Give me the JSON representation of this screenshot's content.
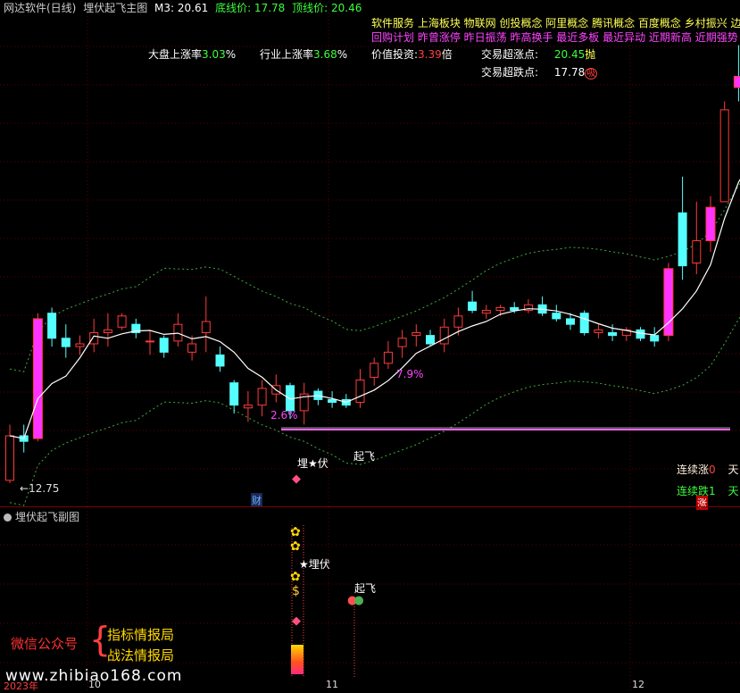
{
  "header": {
    "app": "网达软件(日线)",
    "indicator": "埋伏起飞主图",
    "m3_label": "M3: 20.61",
    "bottom_label": "底线价: 17.78",
    "top_label": "顶线价: 20.46"
  },
  "concepts": {
    "line1": "软件服务 上海板块 物联网 创投概念 阿里概念 腾讯概念 百度概念 乡村振兴 边缘计",
    "line2": "回购计划 昨曾涨停 昨日振荡 昨高换手 最近多板 最近异动 近期新高 近期强势 前"
  },
  "stats": {
    "market_label": "大盘上涨率",
    "market_value": "3.03",
    "market_unit": "%",
    "industry_label": "行业上涨率",
    "industry_value": "3.68",
    "industry_unit": "%",
    "value_label": "价值投资:",
    "value_value": "3.39",
    "value_unit": "倍",
    "rise_label": "交易超涨点:",
    "rise_value": "20.45",
    "rise_tag": "抛",
    "fall_label": "交易超跌点:",
    "fall_value": "17.78",
    "fall_tag": "吸"
  },
  "annotations": {
    "pct1": "2.6%",
    "pct2": "7.9%",
    "low_label": "12.75",
    "maifu": "埋★伏",
    "qifei": "起飞",
    "cai": "财",
    "up_days_label": "连续涨",
    "up_days": "0",
    "down_days_label": "连续跌",
    "down_days": "1",
    "day_unit": "天",
    "zhang": "涨"
  },
  "sub": {
    "title": "埋伏起飞副图",
    "maifu": "★埋伏",
    "qifei": "起飞"
  },
  "watermark": {
    "wechat": "微信公众号",
    "brace": "{",
    "line1": "指标情报局",
    "line2": "战法情报局",
    "url": "www.zhibiao168.com"
  },
  "axis": {
    "year": "2023年",
    "m10": "10",
    "m11": "11",
    "m12": "12"
  },
  "colors": {
    "up": "#ff3a3a",
    "down": "#55ffff",
    "magenta": "#ff33ff",
    "yellow": "#ffff55",
    "green": "#3cff3c",
    "dotted_green": "#3faa3f",
    "axis_red": "#7a0000"
  },
  "chart_data": {
    "type": "candlestick",
    "y_reference": {
      "bottom_line": 17.78,
      "top_line": 20.46,
      "m3": 20.61,
      "low": 12.75
    },
    "candles": [
      {
        "o": 12.8,
        "h": 13.8,
        "l": 12.75,
        "c": 13.6
      },
      {
        "o": 13.6,
        "h": 13.8,
        "l": 13.3,
        "c": 13.5
      },
      {
        "o": 13.55,
        "h": 15.8,
        "l": 13.5,
        "c": 15.7,
        "special": "magenta"
      },
      {
        "o": 15.8,
        "h": 15.9,
        "l": 15.2,
        "c": 15.35
      },
      {
        "o": 15.35,
        "h": 15.6,
        "l": 15.0,
        "c": 15.2
      },
      {
        "o": 15.2,
        "h": 15.4,
        "l": 15.05,
        "c": 15.25
      },
      {
        "o": 15.25,
        "h": 15.7,
        "l": 15.1,
        "c": 15.45
      },
      {
        "o": 15.45,
        "h": 15.8,
        "l": 15.2,
        "c": 15.5
      },
      {
        "o": 15.55,
        "h": 15.8,
        "l": 15.5,
        "c": 15.75
      },
      {
        "o": 15.6,
        "h": 15.7,
        "l": 15.35,
        "c": 15.45
      },
      {
        "o": 15.3,
        "h": 15.5,
        "l": 15.05,
        "c": 15.3
      },
      {
        "o": 15.35,
        "h": 15.4,
        "l": 15.0,
        "c": 15.1
      },
      {
        "o": 15.3,
        "h": 15.8,
        "l": 15.2,
        "c": 15.6
      },
      {
        "o": 15.1,
        "h": 15.4,
        "l": 14.95,
        "c": 15.25
      },
      {
        "o": 15.45,
        "h": 16.1,
        "l": 15.1,
        "c": 15.65
      },
      {
        "o": 15.05,
        "h": 15.2,
        "l": 14.75,
        "c": 14.85
      },
      {
        "o": 14.55,
        "h": 14.6,
        "l": 14.0,
        "c": 14.15
      },
      {
        "o": 14.1,
        "h": 14.4,
        "l": 13.85,
        "c": 14.15
      },
      {
        "o": 14.15,
        "h": 14.6,
        "l": 13.95,
        "c": 14.45
      },
      {
        "o": 14.35,
        "h": 14.7,
        "l": 14.2,
        "c": 14.5
      },
      {
        "o": 14.5,
        "h": 14.55,
        "l": 13.9,
        "c": 14.05
      },
      {
        "o": 14.05,
        "h": 14.55,
        "l": 13.8,
        "c": 14.35
      },
      {
        "o": 14.4,
        "h": 14.45,
        "l": 14.15,
        "c": 14.25
      },
      {
        "o": 14.25,
        "h": 14.4,
        "l": 14.1,
        "c": 14.2
      },
      {
        "o": 14.25,
        "h": 14.35,
        "l": 14.1,
        "c": 14.15
      },
      {
        "o": 14.2,
        "h": 14.8,
        "l": 14.1,
        "c": 14.6
      },
      {
        "o": 14.65,
        "h": 15.0,
        "l": 14.5,
        "c": 14.9
      },
      {
        "o": 14.9,
        "h": 15.3,
        "l": 14.8,
        "c": 15.1
      },
      {
        "o": 15.2,
        "h": 15.5,
        "l": 15.0,
        "c": 15.35
      },
      {
        "o": 15.4,
        "h": 15.6,
        "l": 15.2,
        "c": 15.45
      },
      {
        "o": 15.4,
        "h": 15.5,
        "l": 15.2,
        "c": 15.25
      },
      {
        "o": 15.25,
        "h": 15.7,
        "l": 15.1,
        "c": 15.55
      },
      {
        "o": 15.55,
        "h": 15.9,
        "l": 15.4,
        "c": 15.75
      },
      {
        "o": 16.0,
        "h": 16.2,
        "l": 15.8,
        "c": 15.85
      },
      {
        "o": 15.8,
        "h": 15.95,
        "l": 15.7,
        "c": 15.85
      },
      {
        "o": 15.85,
        "h": 15.95,
        "l": 15.75,
        "c": 15.9
      },
      {
        "o": 15.9,
        "h": 16.0,
        "l": 15.8,
        "c": 15.85
      },
      {
        "o": 15.85,
        "h": 16.05,
        "l": 15.8,
        "c": 15.95
      },
      {
        "o": 15.95,
        "h": 16.1,
        "l": 15.75,
        "c": 15.8
      },
      {
        "o": 15.8,
        "h": 15.95,
        "l": 15.65,
        "c": 15.7
      },
      {
        "o": 15.7,
        "h": 15.8,
        "l": 15.5,
        "c": 15.6
      },
      {
        "o": 15.8,
        "h": 15.85,
        "l": 15.4,
        "c": 15.45
      },
      {
        "o": 15.45,
        "h": 15.6,
        "l": 15.35,
        "c": 15.5
      },
      {
        "o": 15.45,
        "h": 15.6,
        "l": 15.3,
        "c": 15.4
      },
      {
        "o": 15.4,
        "h": 15.55,
        "l": 15.3,
        "c": 15.5
      },
      {
        "o": 15.5,
        "h": 15.55,
        "l": 15.3,
        "c": 15.35
      },
      {
        "o": 15.4,
        "h": 15.55,
        "l": 15.2,
        "c": 15.3
      },
      {
        "o": 15.4,
        "h": 16.7,
        "l": 15.3,
        "c": 16.6,
        "special": "magenta"
      },
      {
        "o": 17.6,
        "h": 18.25,
        "l": 16.4,
        "c": 16.65
      },
      {
        "o": 16.7,
        "h": 17.8,
        "l": 16.5,
        "c": 17.1
      },
      {
        "o": 17.1,
        "h": 17.9,
        "l": 16.9,
        "c": 17.7,
        "special": "magenta"
      },
      {
        "o": 17.8,
        "h": 19.6,
        "l": 17.8,
        "c": 19.45
      },
      {
        "o": 20.05,
        "h": 20.61,
        "l": 19.6,
        "c": 19.85,
        "special": "magenta_top"
      },
      {
        "o": 19.6,
        "h": 19.75,
        "l": 18.7,
        "c": 18.8
      }
    ]
  }
}
